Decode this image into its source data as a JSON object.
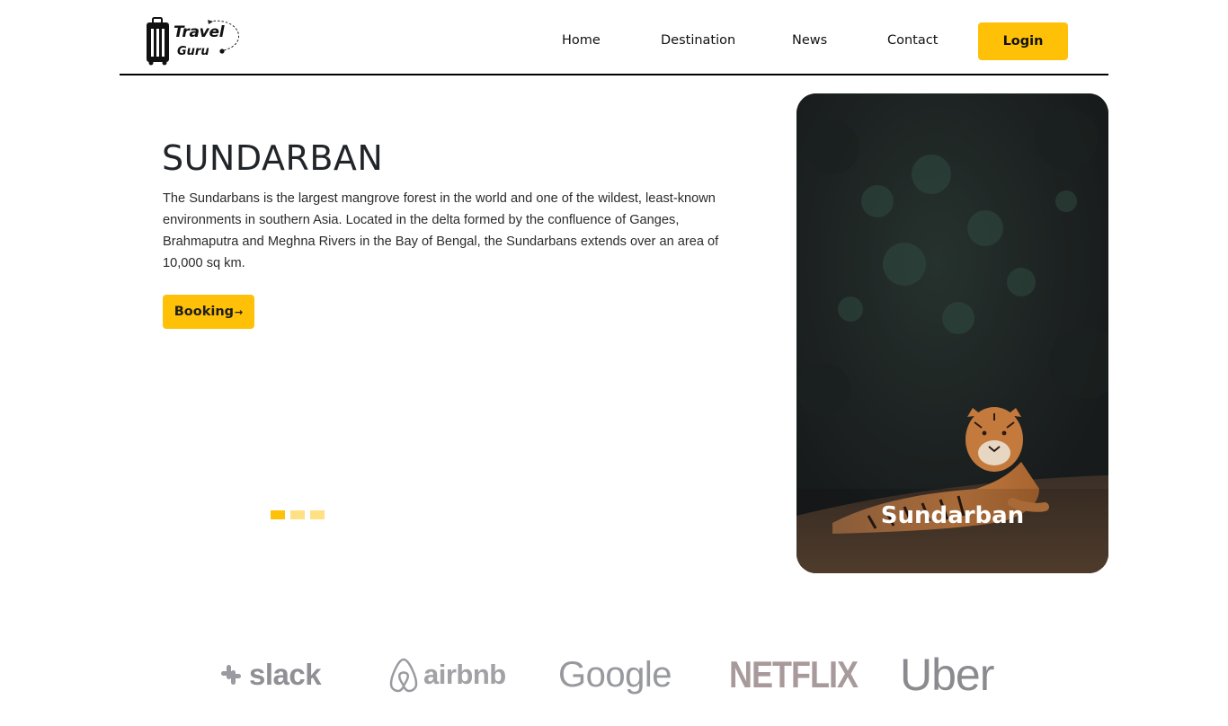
{
  "brand": {
    "logo_line1": "Travel",
    "logo_line2": "Guru",
    "logo_icon": "suitcase-icon"
  },
  "nav": {
    "items": [
      "Home",
      "Destination",
      "News",
      "Contact"
    ],
    "login_label": "Login"
  },
  "hero": {
    "title": "SUNDARBAN",
    "description": "The Sundarbans is the largest mangrove forest in the world and one of the wildest, least-known environments in southern Asia. Located in the delta formed by the confluence of Ganges, Brahmaputra and Meghna Rivers in the Bay of Bengal, the Sundarbans extends over an area of 10,000 sq km.",
    "booking_label": "Booking",
    "booking_arrow": "→",
    "slides_total": 3,
    "active_slide": 1
  },
  "card": {
    "label": "Sundarban",
    "image": "tiger-in-forest"
  },
  "partners": [
    "slack",
    "airbnb",
    "Google",
    "NETFLIX",
    "Uber"
  ],
  "colors": {
    "accent": "#FFC107",
    "text": "#212529",
    "brand_gray": "#8f8f95"
  }
}
